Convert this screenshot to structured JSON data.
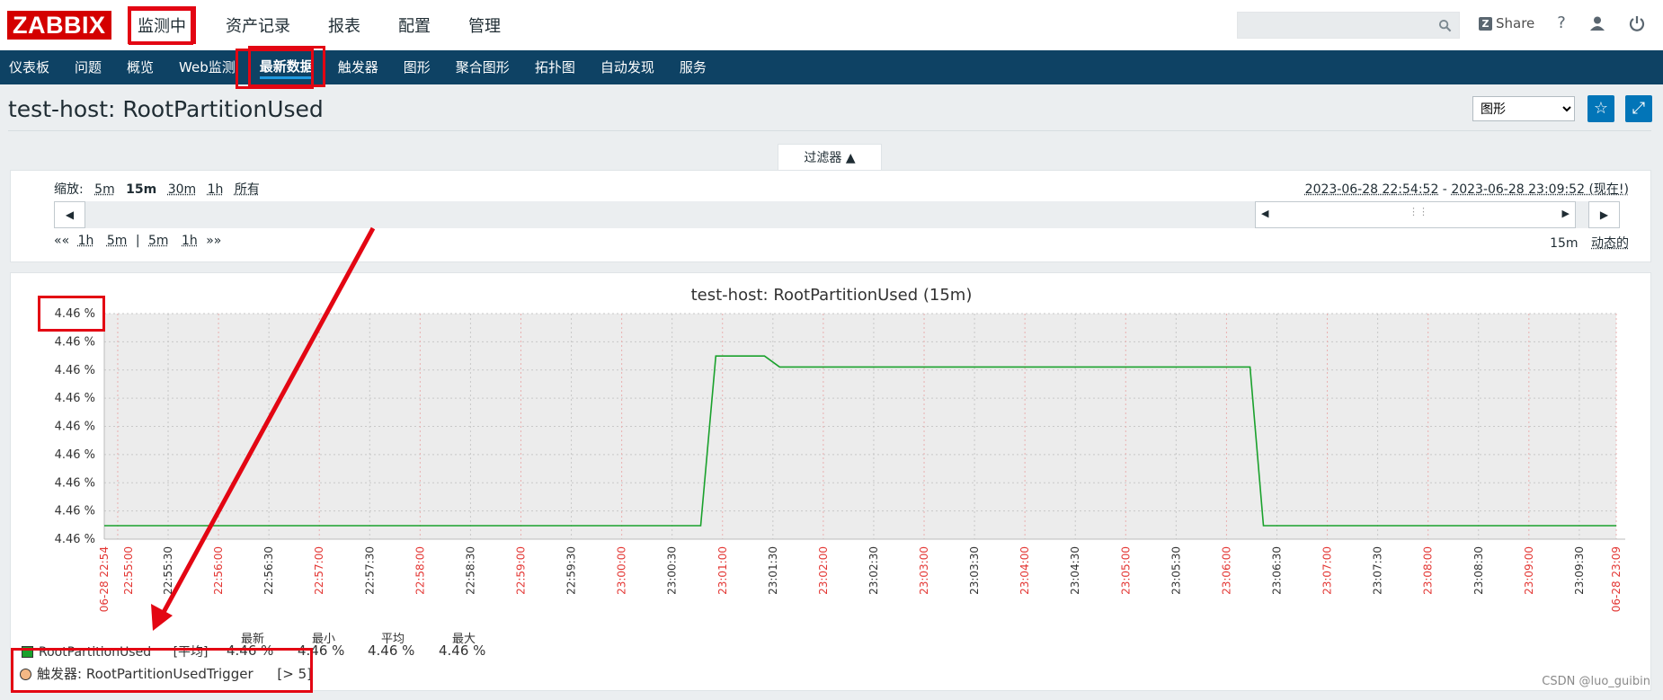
{
  "logo": "ZABBIX",
  "top_nav": [
    "监测中",
    "资产记录",
    "报表",
    "配置",
    "管理"
  ],
  "search": {
    "placeholder": ""
  },
  "share_label": "Share",
  "help_icon": "question-icon",
  "sub_nav": [
    "仪表板",
    "问题",
    "概览",
    "Web监测",
    "最新数据",
    "触发器",
    "图形",
    "聚合图形",
    "拓扑图",
    "自动发现",
    "服务"
  ],
  "page_title": "test-host: RootPartitionUsed",
  "view_select": "图形",
  "filter": {
    "tab_label": "过滤器 ▲",
    "zoom_label": "缩放:",
    "zoom_options": [
      "5m",
      "15m",
      "30m",
      "1h",
      "所有"
    ],
    "range_from": "2023-06-28 22:54:52",
    "range_sep": " - ",
    "range_to": "2023-06-28 23:09:52 (现在!)",
    "nav_back": "««",
    "nav_left": [
      "1h",
      "5m"
    ],
    "nav_sep": "|",
    "nav_right": [
      "5m",
      "1h"
    ],
    "nav_fwd": "»»",
    "period": "15m",
    "live": "动态的"
  },
  "chart_data": {
    "type": "line",
    "title": "test-host: RootPartitionUsed (15m)",
    "y_tick_labels": [
      "4.46 %",
      "4.46 %",
      "4.46 %",
      "4.46 %",
      "4.46 %",
      "4.46 %",
      "4.46 %",
      "4.46 %",
      "4.46 %"
    ],
    "x_tick_labels": [
      {
        "t": "06-28 22:54",
        "red": true
      },
      {
        "t": "22:55:00",
        "red": true
      },
      {
        "t": "22:55:30",
        "red": false
      },
      {
        "t": "22:56:00",
        "red": true
      },
      {
        "t": "22:56:30",
        "red": false
      },
      {
        "t": "22:57:00",
        "red": true
      },
      {
        "t": "22:57:30",
        "red": false
      },
      {
        "t": "22:58:00",
        "red": true
      },
      {
        "t": "22:58:30",
        "red": false
      },
      {
        "t": "22:59:00",
        "red": true
      },
      {
        "t": "22:59:30",
        "red": false
      },
      {
        "t": "23:00:00",
        "red": true
      },
      {
        "t": "23:00:30",
        "red": false
      },
      {
        "t": "23:01:00",
        "red": true
      },
      {
        "t": "23:01:30",
        "red": false
      },
      {
        "t": "23:02:00",
        "red": true
      },
      {
        "t": "23:02:30",
        "red": false
      },
      {
        "t": "23:03:00",
        "red": true
      },
      {
        "t": "23:03:30",
        "red": false
      },
      {
        "t": "23:04:00",
        "red": true
      },
      {
        "t": "23:04:30",
        "red": false
      },
      {
        "t": "23:05:00",
        "red": true
      },
      {
        "t": "23:05:30",
        "red": false
      },
      {
        "t": "23:06:00",
        "red": true
      },
      {
        "t": "23:06:30",
        "red": false
      },
      {
        "t": "23:07:00",
        "red": true
      },
      {
        "t": "23:07:30",
        "red": false
      },
      {
        "t": "23:08:00",
        "red": true
      },
      {
        "t": "23:08:30",
        "red": false
      },
      {
        "t": "23:09:00",
        "red": true
      },
      {
        "t": "23:09:30",
        "red": false
      },
      {
        "t": "06-28 23:09",
        "red": true
      }
    ],
    "series": [
      {
        "name": "RootPartitionUsed",
        "color": "#1aa12c",
        "x_seconds": [
          0,
          355,
          364,
          393,
          402,
          682,
          690,
          900
        ],
        "y_level": [
          0,
          0,
          0.93,
          0.93,
          0.87,
          0.87,
          0,
          0
        ]
      }
    ],
    "grid": true
  },
  "legend": {
    "item_name": "RootPartitionUsed",
    "item_func": "[平均]",
    "headers": [
      "最新",
      "最小",
      "平均",
      "最大"
    ],
    "values": [
      "4.46 %",
      "4.46 %",
      "4.46 %",
      "4.46 %"
    ],
    "trigger_prefix": "触发器:",
    "trigger_name": "RootPartitionUsedTrigger",
    "trigger_cond": "[> 5]"
  },
  "watermark": "CSDN @luo_guibin",
  "colors": {
    "accent": "#0e4264",
    "annotation": "#e30613",
    "series": "#1aa12c"
  }
}
